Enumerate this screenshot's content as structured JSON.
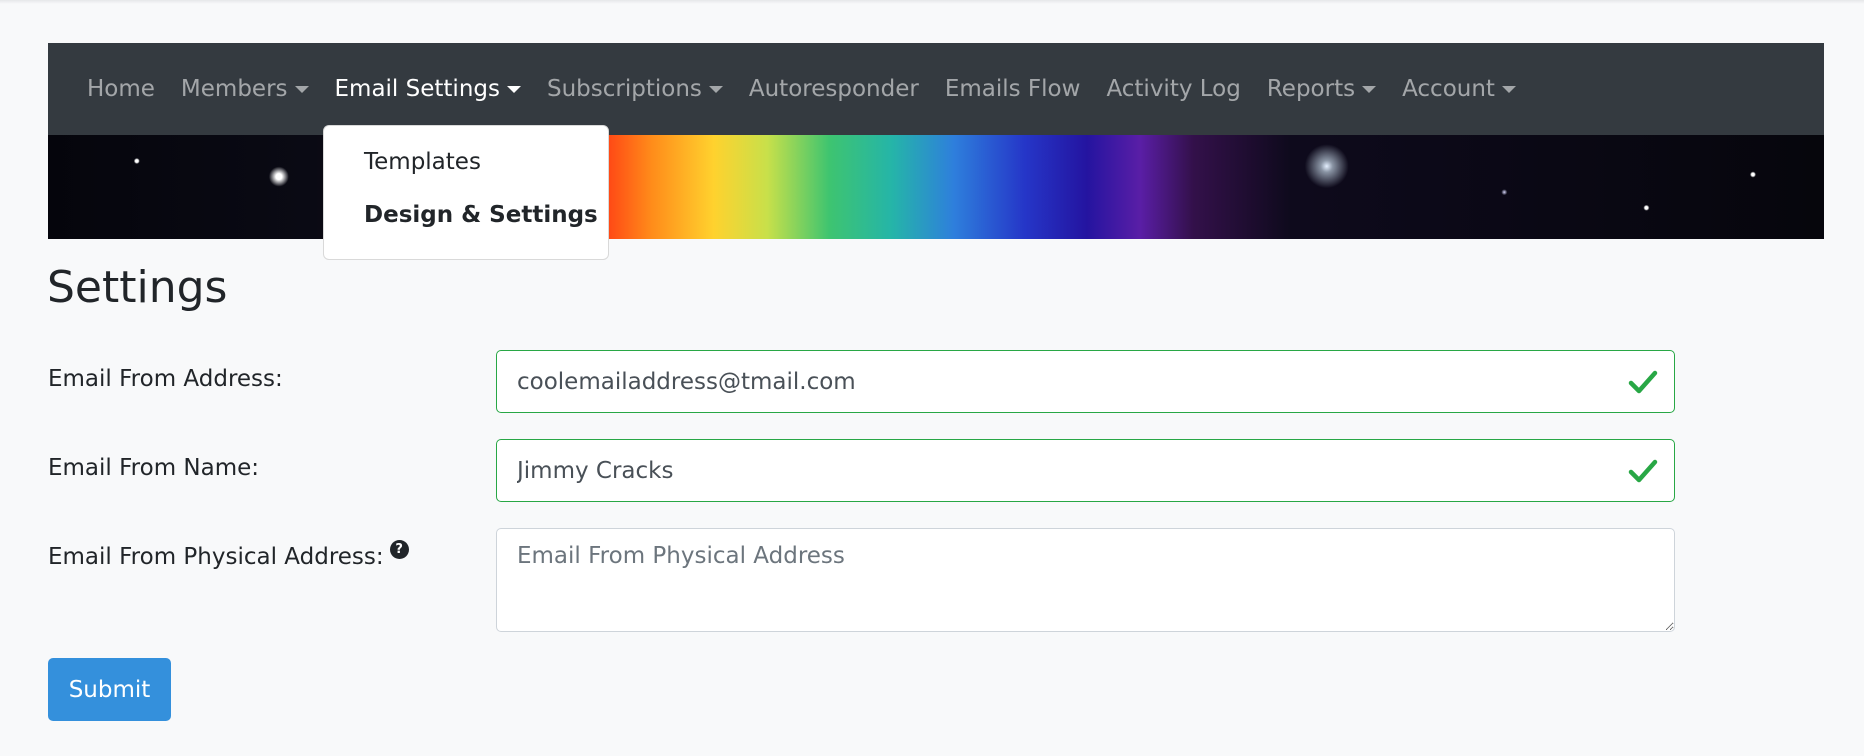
{
  "nav": {
    "items": [
      {
        "label": "Home",
        "dropdown": false,
        "active": false
      },
      {
        "label": "Members",
        "dropdown": true,
        "active": false
      },
      {
        "label": "Email Settings",
        "dropdown": true,
        "active": true
      },
      {
        "label": "Subscriptions",
        "dropdown": true,
        "active": false
      },
      {
        "label": "Autoresponder",
        "dropdown": false,
        "active": false
      },
      {
        "label": "Emails Flow",
        "dropdown": false,
        "active": false
      },
      {
        "label": "Activity Log",
        "dropdown": false,
        "active": false
      },
      {
        "label": "Reports",
        "dropdown": true,
        "active": false
      },
      {
        "label": "Account",
        "dropdown": true,
        "active": false
      }
    ]
  },
  "dropdown": {
    "items": [
      {
        "label": "Templates"
      },
      {
        "label": "Design & Settings"
      }
    ]
  },
  "page": {
    "title": "Settings"
  },
  "form": {
    "from_address_label": "Email From Address:",
    "from_address_value": "coolemailaddress@tmail.com",
    "from_name_label": "Email From Name:",
    "from_name_value": "Jimmy Cracks",
    "physical_address_label": "Email From Physical Address:",
    "physical_address_placeholder": "Email From Physical Address",
    "help_glyph": "?",
    "submit_label": "Submit"
  },
  "colors": {
    "navbar": "#343a40",
    "valid": "#28a745",
    "primary": "#3490dc"
  }
}
